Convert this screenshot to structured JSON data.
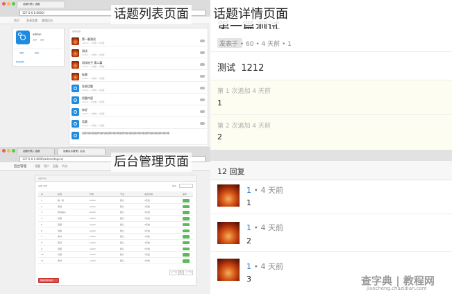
{
  "labels": {
    "list": "话题列表页面",
    "detail": "话题详情页面",
    "admin": "后台管理页面"
  },
  "list_page": {
    "tab": "话题列表 | 话题",
    "url": "127.0.0.1:8000/",
    "nav": [
      "首页",
      "发表话题",
      "管理后台"
    ],
    "user_name": "admin",
    "user_stats": [
      "话题",
      "回复"
    ],
    "user_link": "修改资料",
    "section_title": "最新话题",
    "topics": [
      {
        "title": "第一篇测试",
        "meta": "admin • 4天前 • 1回复"
      },
      {
        "title": "测试",
        "meta": "admin • 4天前 • 0回复"
      },
      {
        "title": "测试帖子 第二篇",
        "meta": "admin • 4天前 • 1回复"
      },
      {
        "title": "标题",
        "meta": "admin • 4天前 • 0回复"
      },
      {
        "title": "发表话题",
        "meta": "admin • 4天前 • 0回复"
      },
      {
        "title": "话题内容",
        "meta": "admin • 4天前 • 0回复"
      },
      {
        "title": "你好",
        "meta": "admin • 4天前 • 0回复"
      },
      {
        "title": "话题",
        "meta": "admin • 4天前 • 0回复"
      }
    ],
    "long_text": "话题内容内容话题内容内容话题内容内容话题内容内容话题内容内容话题内容内容话题内容内容"
  },
  "admin_page": {
    "tabs": [
      "话题列表 | 话题",
      "话题后台管理 | 后台"
    ],
    "url": "127.0.0.1:8000/admin/topics/",
    "nav": [
      "后台管理",
      "话题",
      "用户",
      "回复",
      "节点"
    ],
    "panel_title": "话题列表",
    "filter_label": "话题 全部",
    "search_label": "搜索",
    "columns": [
      "ID",
      "标题",
      "作者",
      "节点",
      "发表时间",
      "操作"
    ],
    "rows": [
      [
        "1",
        "第一篇",
        "admin",
        "默认",
        "4天前"
      ],
      [
        "2",
        "测试",
        "admin",
        "默认",
        "4天前"
      ],
      [
        "3",
        "测试帖子",
        "admin",
        "默认",
        "4天前"
      ],
      [
        "4",
        "标题",
        "admin",
        "默认",
        "4天前"
      ],
      [
        "5",
        "话题",
        "admin",
        "默认",
        "4天前"
      ],
      [
        "6",
        "内容",
        "admin",
        "默认",
        "4天前"
      ],
      [
        "7",
        "你好",
        "admin",
        "默认",
        "4天前"
      ],
      [
        "8",
        "测试",
        "admin",
        "默认",
        "4天前"
      ],
      [
        "9",
        "话题",
        "admin",
        "默认",
        "4天前"
      ],
      [
        "10",
        "内容",
        "admin",
        "默认",
        "4天前"
      ],
      [
        "11",
        "测试",
        "admin",
        "默认",
        "4天前"
      ]
    ],
    "action_label": "编辑",
    "pagination": [
      "上一页",
      "1",
      "下一页"
    ],
    "delete_label": "删除选中话题"
  },
  "detail_page": {
    "topic_title": "第一篇测试",
    "topic_meta": "发表于 • 60 • 4 天前 • 1",
    "topic_content": "测试  1212",
    "appends": [
      {
        "header": "第 1 次追加 4 天前",
        "text": "1"
      },
      {
        "header": "第 2 次追加 4 天前",
        "text": "2"
      }
    ],
    "reply_count": "12 回复",
    "replies": [
      {
        "user": "1",
        "time": " • 4 天前",
        "text": "1"
      },
      {
        "user": "1",
        "time": " • 4 天前",
        "text": "2"
      },
      {
        "user": "1",
        "time": " • 4 天前",
        "text": "3"
      }
    ]
  },
  "watermark": "查字典 | 教程网",
  "watermark_url": "jiaocheng.chazidian.com"
}
